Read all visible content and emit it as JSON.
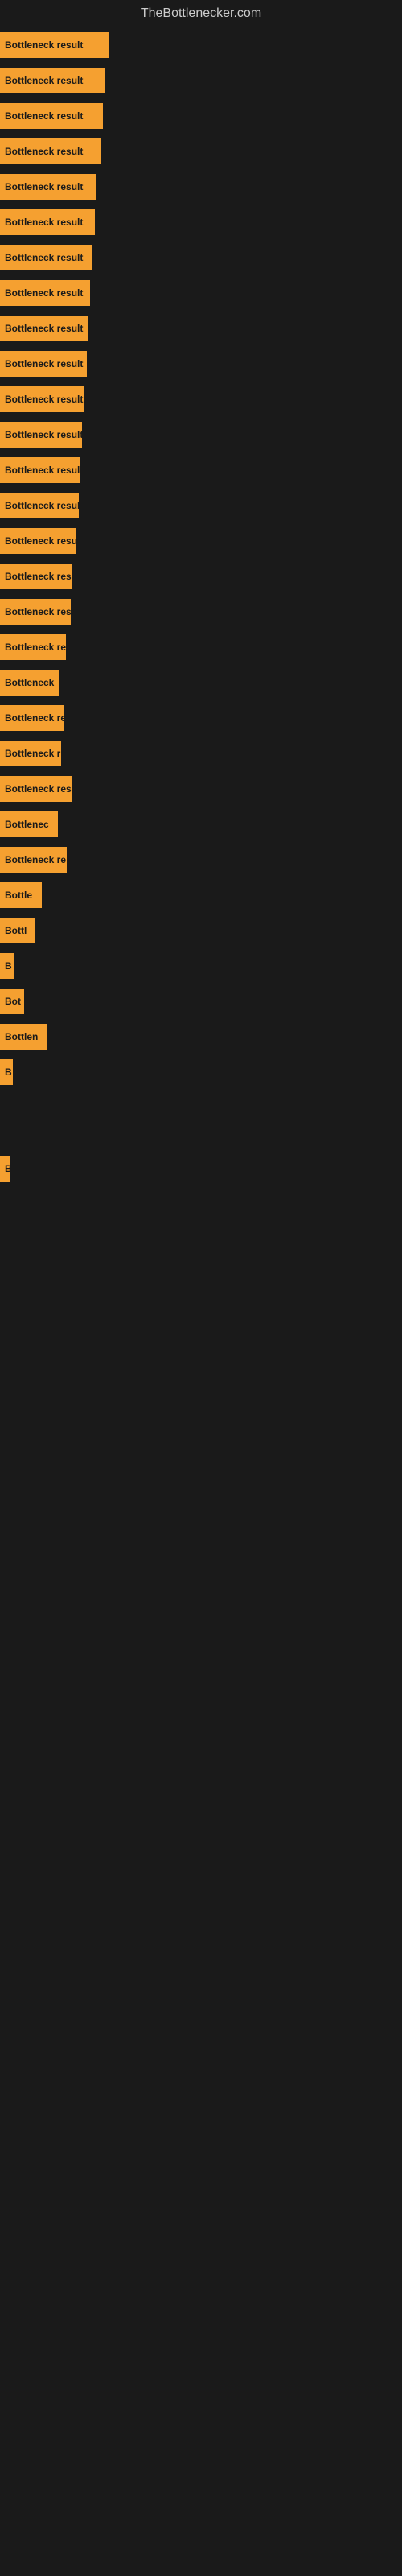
{
  "site": {
    "title": "TheBottlenecker.com"
  },
  "bars": [
    {
      "label": "Bottleneck result",
      "width": 135
    },
    {
      "label": "Bottleneck result",
      "width": 130
    },
    {
      "label": "Bottleneck result",
      "width": 128
    },
    {
      "label": "Bottleneck result",
      "width": 125
    },
    {
      "label": "Bottleneck result",
      "width": 120
    },
    {
      "label": "Bottleneck result",
      "width": 118
    },
    {
      "label": "Bottleneck result",
      "width": 115
    },
    {
      "label": "Bottleneck result",
      "width": 112
    },
    {
      "label": "Bottleneck result",
      "width": 110
    },
    {
      "label": "Bottleneck result",
      "width": 108
    },
    {
      "label": "Bottleneck result",
      "width": 105
    },
    {
      "label": "Bottleneck result",
      "width": 102
    },
    {
      "label": "Bottleneck result",
      "width": 100
    },
    {
      "label": "Bottleneck result",
      "width": 98
    },
    {
      "label": "Bottleneck result",
      "width": 95
    },
    {
      "label": "Bottleneck resu",
      "width": 90
    },
    {
      "label": "Bottleneck result",
      "width": 88
    },
    {
      "label": "Bottleneck re",
      "width": 82
    },
    {
      "label": "Bottleneck",
      "width": 74
    },
    {
      "label": "Bottleneck res",
      "width": 80
    },
    {
      "label": "Bottleneck r",
      "width": 76
    },
    {
      "label": "Bottleneck resu",
      "width": 89
    },
    {
      "label": "Bottlenec",
      "width": 72
    },
    {
      "label": "Bottleneck re",
      "width": 83
    },
    {
      "label": "Bottle",
      "width": 52
    },
    {
      "label": "Bottl",
      "width": 44
    },
    {
      "label": "B",
      "width": 18
    },
    {
      "label": "Bot",
      "width": 30
    },
    {
      "label": "Bottlen",
      "width": 58
    },
    {
      "label": "B",
      "width": 16
    },
    {
      "label": "",
      "width": 0
    },
    {
      "label": "",
      "width": 0
    },
    {
      "label": "B",
      "width": 12
    },
    {
      "label": "",
      "width": 0
    },
    {
      "label": "",
      "width": 0
    }
  ]
}
